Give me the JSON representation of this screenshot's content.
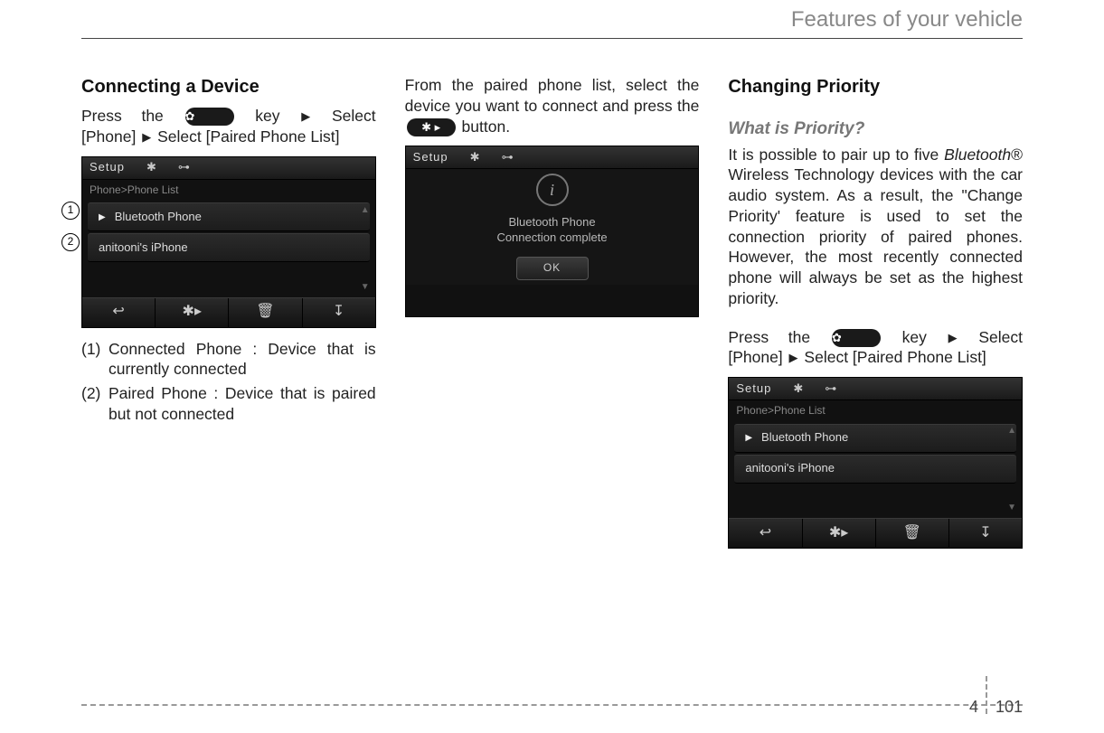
{
  "header": {
    "title": "Features of your vehicle"
  },
  "page": {
    "chapter": "4",
    "number": "101"
  },
  "col1": {
    "heading": "Connecting a Device",
    "proc_line1_a": "Press   the",
    "proc_line1_b": "key",
    "proc_line1_c": "Select",
    "proc_line2": "[Phone]",
    "proc_line2_b": "Select [Paired Phone List]",
    "settings_icon": "✿",
    "screen": {
      "setup": "Setup",
      "bt_icon": "✱",
      "link_icon": "⊶",
      "breadcrumb": "Phone>Phone List",
      "item1_marker": "▶",
      "item1": "Bluetooth Phone",
      "item2": "anitooni's iPhone",
      "bb1": "↩",
      "bb2": "✱▸",
      "bb3": "🗑",
      "bb4": "↧",
      "scroll_up": "▲",
      "scroll_down": "▼"
    },
    "callouts": {
      "one": "1",
      "two": "2"
    },
    "legend": {
      "l1_num": "(1)",
      "l1": "Connected Phone : Device that is currently connected",
      "l2_num": "(2)",
      "l2": "Paired Phone : Device that is paired but not connected"
    }
  },
  "col2": {
    "para1": "From the paired phone list, select the device you want to connect and press the",
    "bt_btn_icon": "✱ ▸",
    "para1_tail": " button.",
    "screen": {
      "setup": "Setup",
      "bt_icon": "✱",
      "link_icon": "⊶",
      "info_icon": "i",
      "msg_line1": "Bluetooth Phone",
      "msg_line2": "Connection complete",
      "ok": "OK"
    }
  },
  "col3": {
    "heading": "Changing Priority",
    "subhead": "What is Priority?",
    "para_a": "It is possible to pair up to five ",
    "brand": "Bluetooth",
    "reg": "®",
    "para_b": " Wireless Technology devices with the car audio system. As a result, the \"Change Priority' feature is used to set the connection priority of paired phones. However, the most recently connected phone will always be set as the highest priority.",
    "proc_line1_a": "Press   the",
    "proc_line1_b": "key",
    "proc_line1_c": "Select",
    "proc_line2": "[Phone] ",
    "proc_line2_b": "Select [Paired Phone List]",
    "settings_icon": "✿",
    "screen": {
      "setup": "Setup",
      "bt_icon": "✱",
      "link_icon": "⊶",
      "breadcrumb": "Phone>Phone List",
      "item1_marker": "▶",
      "item1": "Bluetooth Phone",
      "item2": "anitooni's iPhone",
      "bb1": "↩",
      "bb2": "✱▸",
      "bb3": "🗑",
      "bb4": "↧",
      "scroll_up": "▲",
      "scroll_down": "▼"
    }
  }
}
